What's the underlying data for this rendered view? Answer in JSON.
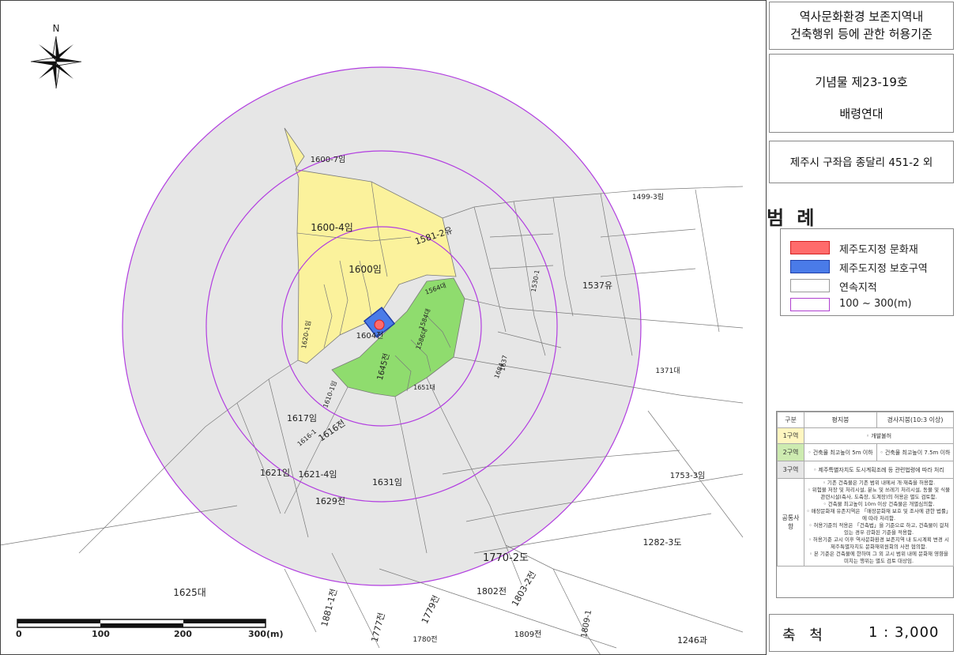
{
  "panel": {
    "title_line1": "역사문화환경 보존지역내",
    "title_line2": "건축행위 등에 관한 허용기준",
    "monument_no": "기념물 제23-19호",
    "monument_name": "배령연대",
    "address": "제주시 구좌읍 종달리 451-2 외",
    "legend_title": "범 례",
    "legend": [
      {
        "label": "제주도지정 문화재",
        "color": "#ff6b6b",
        "border": "#d42020"
      },
      {
        "label": "제주도지정 보호구역",
        "color": "#4a7be8",
        "border": "#1f3fa8"
      },
      {
        "label": "연속지적",
        "color": "#ffffff",
        "border": "#9a9a9a"
      },
      {
        "label": "100 ~ 300(m)",
        "color": "#ffffff",
        "border": "#b040d0"
      }
    ],
    "rules": {
      "header": [
        "구분",
        "평지붕",
        "경사지붕(10:3 이상)"
      ],
      "zone1": {
        "label": "1구역",
        "text": "◦ 개발불허",
        "color": "#fff6c0"
      },
      "zone2": {
        "label": "2구역",
        "text_a": "◦ 건축물 최고높이 5m 이하",
        "text_b": "◦ 건축물 최고높이 7.5m 이하",
        "color": "#cdebb0"
      },
      "zone3": {
        "label": "3구역",
        "text": "◦ 제주특별자치도 도시계획조례 등 관련법령에 따라 처리",
        "color": "#e6e6e6"
      },
      "common_label": "공통사항",
      "common": [
        "◦ 기존 건축물은 기존 범위 내에서 개·재축을 허용함.",
        "◦ 위험물 저장 및 처리시설, 분뇨 및 쓰레기 처리시설, 동물 및 식물 관련시설(축사, 도축장, 도계장)의 허용은 별도 검토함.",
        "◦ 건축물 최고높이 10m 이상 건축물은 개별심의함.",
        "◦ 매장문화재 유존지역은 「매장문화재 보호 및 조사에 관한 법률」에 따라 처리함.",
        "◦ 허용기준의 적용은 「건축법」을 기준으로 하고, 건축물이 걸쳐 있는 경우 강화된 기준을 적용함.",
        "◦ 허용기준 고시 이후 역사문화환경 보존지역 내 도시계획 변경 시 제주특별자치도 문화재위원회의 사전 협의함.",
        "◦ 본 기준은 건축물에 한하며 그 외 고시 범위 내에 문화재 영향을 미치는 행위는 별도 검토 대상임."
      ]
    },
    "scale_label": "축 척",
    "scale_value": "1 : 3,000"
  },
  "map": {
    "north_label": "N",
    "scalebar_labels": [
      "0",
      "100",
      "200",
      "300(m)"
    ],
    "colors": {
      "zone1": "#fbf29c",
      "zone2": "#8fdc6e",
      "zone3": "#e6e6e6",
      "ring": "#b23ee0",
      "parcel": "#7a7a7a"
    },
    "parcel_labels": [
      "1600-7임",
      "1600-4임",
      "1581-2유",
      "1600임",
      "1604전",
      "1645전",
      "1617임",
      "1616전",
      "1621임",
      "1621-4임",
      "1629전",
      "1631임",
      "1625대",
      "1770-2도",
      "1537유",
      "1499-3림",
      "1753-3임",
      "1282-3도",
      "1802전",
      "1803-2전",
      "1779전",
      "1780전",
      "1809전",
      "1246과",
      "1881-1전",
      "1777전",
      "1809-1",
      "1651대",
      "1610-1임",
      "1616-1",
      "1637",
      "1684",
      "1530-1",
      "1371대",
      "1564대",
      "1584대",
      "1586대",
      "1620-1임"
    ]
  }
}
